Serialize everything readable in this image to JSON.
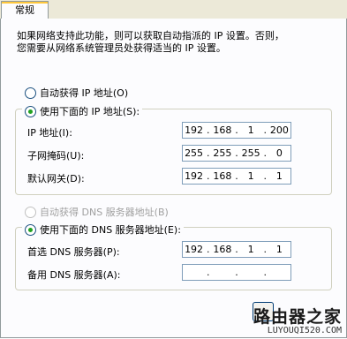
{
  "tab": {
    "label": "常规"
  },
  "description": {
    "line1": "如果网络支持此功能，则可以获取自动指派的 IP 设置。否则，",
    "line2": "您需要从网络系统管理员处获得适当的 IP 设置。"
  },
  "ip": {
    "auto_label": "自动获得 IP 地址(O)",
    "manual_label": "使用下面的 IP 地址(S):",
    "selected": "manual",
    "fields": [
      {
        "label": "IP 地址(I):",
        "octets": [
          "192",
          "168",
          "1",
          "200"
        ]
      },
      {
        "label": "子网掩码(U):",
        "octets": [
          "255",
          "255",
          "255",
          "0"
        ]
      },
      {
        "label": "默认网关(D):",
        "octets": [
          "192",
          "168",
          "1",
          "1"
        ]
      }
    ]
  },
  "dns": {
    "auto_label": "自动获得 DNS 服务器地址(B)",
    "auto_enabled": false,
    "manual_label": "使用下面的 DNS 服务器地址(E):",
    "selected": "manual",
    "fields": [
      {
        "label": "首选 DNS 服务器(P):",
        "octets": [
          "192",
          "168",
          "1",
          "1"
        ]
      },
      {
        "label": "备用 DNS 服务器(A):",
        "octets": [
          "",
          "",
          "",
          ""
        ]
      }
    ]
  },
  "watermark": {
    "title": "路由器之家",
    "url": "LUYOUQI520.COM"
  },
  "colors": {
    "radio_selected": "#21a121",
    "tab_highlight": "#ffc83c",
    "border": "#919b9c"
  }
}
